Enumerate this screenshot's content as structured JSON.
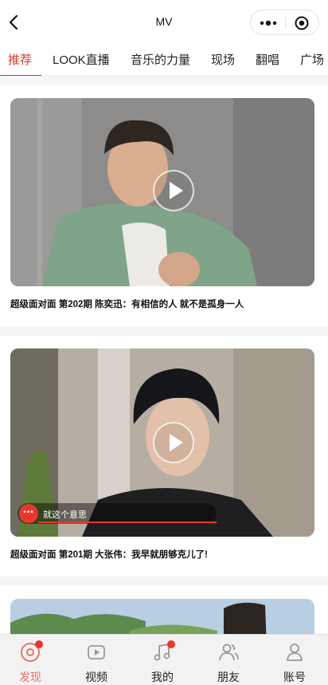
{
  "header": {
    "title": "MV"
  },
  "tabs": [
    {
      "label": "推荐",
      "active": true
    },
    {
      "label": "LOOK直播"
    },
    {
      "label": "音乐的力量"
    },
    {
      "label": "现场"
    },
    {
      "label": "翻唱"
    },
    {
      "label": "广场"
    }
  ],
  "videos": [
    {
      "title": "超级面对面 第202期 陈奕迅：有相信的人 就不是孤身一人"
    },
    {
      "title": "超级面对面 第201期 大张伟：我早就朋够克儿了!",
      "danmu": {
        "dots": "•••",
        "text": "就这个意思"
      }
    }
  ],
  "bottom_nav": [
    {
      "label": "发现",
      "icon": "disc-icon",
      "active": true,
      "badge": true
    },
    {
      "label": "视频",
      "icon": "video-icon"
    },
    {
      "label": "我的",
      "icon": "music-note-icon",
      "badge": true
    },
    {
      "label": "朋友",
      "icon": "friends-icon"
    },
    {
      "label": "账号",
      "icon": "account-icon"
    }
  ],
  "colors": {
    "accent": "#d33a31",
    "badge": "#e8382c",
    "nav_active": "#e8746b"
  }
}
